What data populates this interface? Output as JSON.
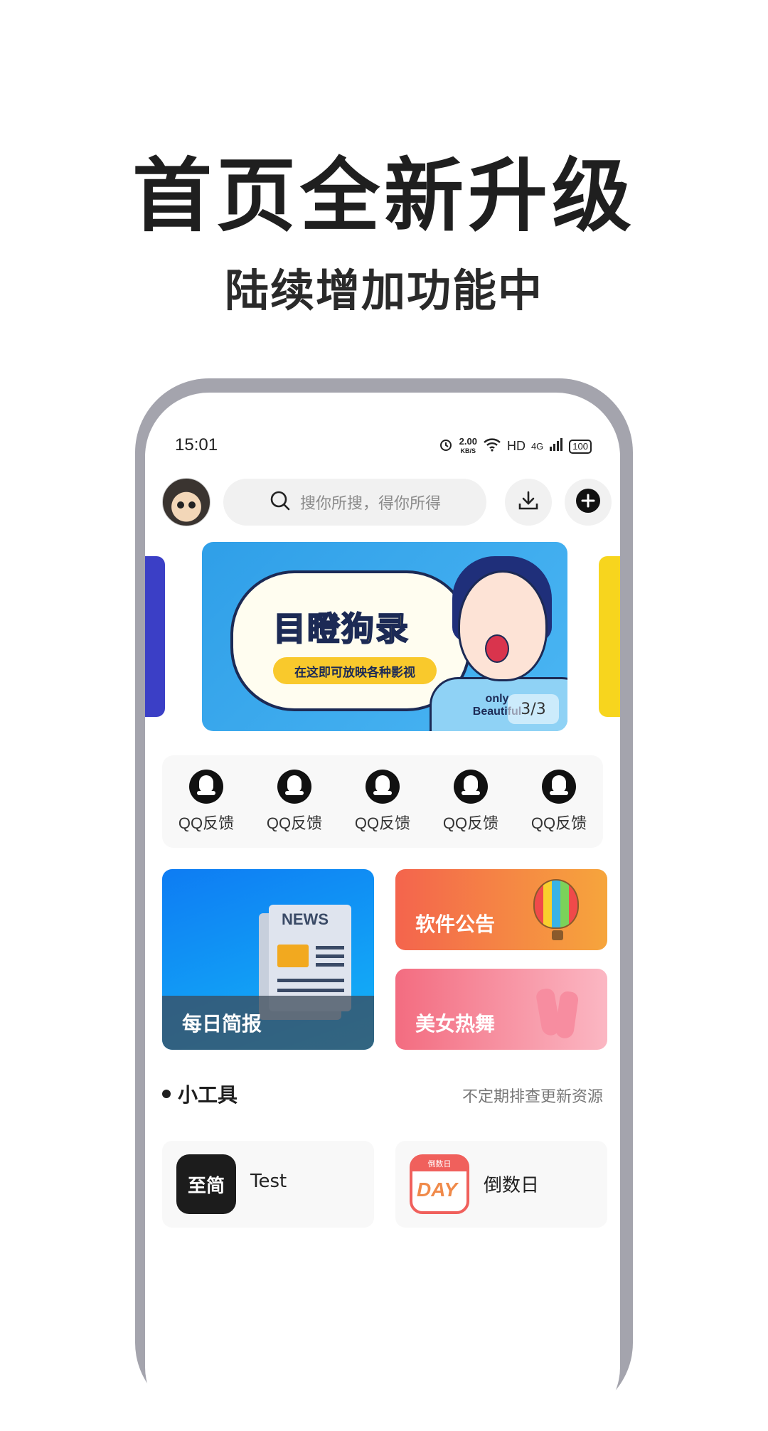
{
  "headline": "首页全新升级",
  "subline": "陆续增加功能中",
  "status_bar": {
    "time": "15:01",
    "net_speed_value": "2.00",
    "net_speed_unit": "KB/S",
    "hd": "HD",
    "network": "4G",
    "battery": "100"
  },
  "search": {
    "placeholder": "搜你所搜，得你所得"
  },
  "banner": {
    "title": "目瞪狗录",
    "tagline": "在这即可放映各种影视",
    "corner_text": "only Beautiful",
    "counter": "3/3"
  },
  "quick_actions": [
    {
      "label": "QQ反馈"
    },
    {
      "label": "QQ反馈"
    },
    {
      "label": "QQ反馈"
    },
    {
      "label": "QQ反馈"
    },
    {
      "label": "QQ反馈"
    }
  ],
  "cards": {
    "news": {
      "label": "每日简报",
      "art_text": "NEWS"
    },
    "notice": {
      "label": "软件公告"
    },
    "dance": {
      "label": "美女热舞"
    }
  },
  "tools_section": {
    "title": "小工具",
    "subtitle": "不定期排查更新资源"
  },
  "tools": [
    {
      "icon_text": "至简",
      "name": "Test"
    },
    {
      "icon_top": "倒数日",
      "icon_text": "DAY",
      "name": "倒数日"
    }
  ]
}
